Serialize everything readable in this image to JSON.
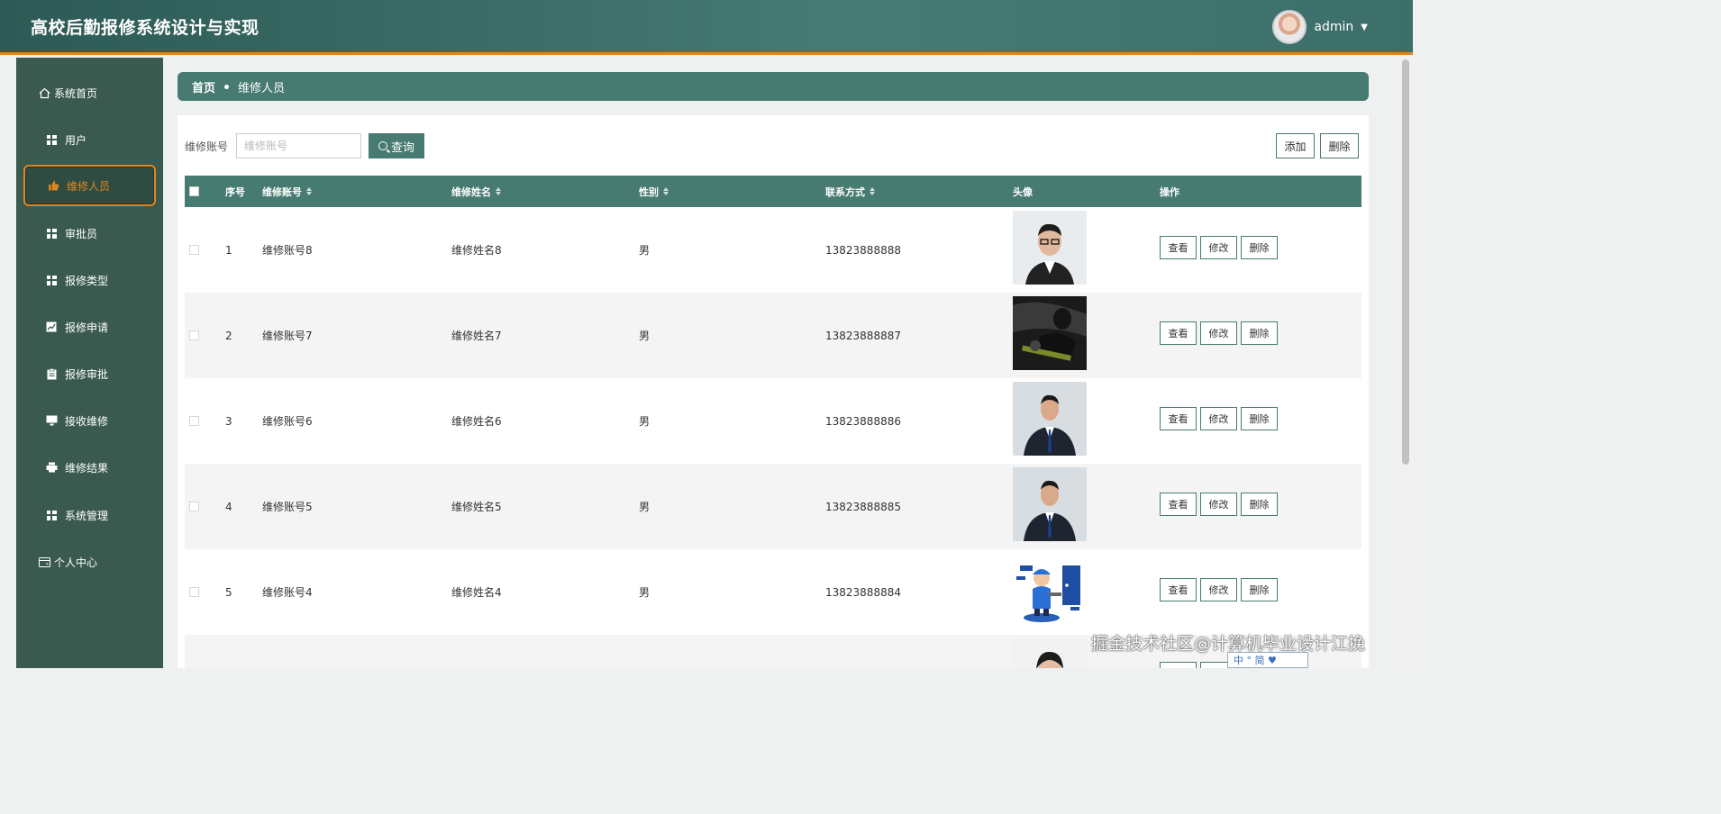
{
  "app": {
    "title": "高校后勤报修系统设计与实现",
    "user": "admin"
  },
  "sidebar": {
    "items": [
      {
        "label": "系统首页",
        "icon": "home-icon"
      },
      {
        "label": "用户",
        "icon": "grid-icon"
      },
      {
        "label": "维修人员",
        "icon": "thumb-icon",
        "active": true
      },
      {
        "label": "审批员",
        "icon": "grid-icon"
      },
      {
        "label": "报修类型",
        "icon": "grid-icon"
      },
      {
        "label": "报修申请",
        "icon": "chart-icon"
      },
      {
        "label": "报修审批",
        "icon": "clipboard-icon"
      },
      {
        "label": "接收维修",
        "icon": "monitor-icon"
      },
      {
        "label": "维修结果",
        "icon": "printer-icon"
      },
      {
        "label": "系统管理",
        "icon": "grid-icon"
      },
      {
        "label": "个人中心",
        "icon": "card-icon"
      }
    ]
  },
  "breadcrumb": {
    "home": "首页",
    "current": "维修人员"
  },
  "search": {
    "label": "维修账号",
    "placeholder": "维修账号",
    "button": "查询"
  },
  "toolbar": {
    "add": "添加",
    "delete": "删除"
  },
  "table": {
    "headers": {
      "index": "序号",
      "account": "维修账号",
      "name": "维修姓名",
      "gender": "性别",
      "phone": "联系方式",
      "avatar": "头像",
      "actions": "操作"
    },
    "rows": [
      {
        "index": "1",
        "account": "维修账号8",
        "name": "维修姓名8",
        "gender": "男",
        "phone": "13823888888"
      },
      {
        "index": "2",
        "account": "维修账号7",
        "name": "维修姓名7",
        "gender": "男",
        "phone": "13823888887"
      },
      {
        "index": "3",
        "account": "维修账号6",
        "name": "维修姓名6",
        "gender": "男",
        "phone": "13823888886"
      },
      {
        "index": "4",
        "account": "维修账号5",
        "name": "维修姓名5",
        "gender": "男",
        "phone": "13823888885"
      },
      {
        "index": "5",
        "account": "维修账号4",
        "name": "维修姓名4",
        "gender": "男",
        "phone": "13823888884"
      }
    ],
    "row_actions": {
      "view": "查看",
      "edit": "修改",
      "delete": "删除"
    }
  },
  "watermark": {
    "text": "掘金技术社区@计算机毕业设计江挽",
    "badge": "中 ° 简 ♥"
  },
  "colors": {
    "primary": "#477a70",
    "accent": "#e0861f",
    "sidebar": "#3a5a50"
  }
}
